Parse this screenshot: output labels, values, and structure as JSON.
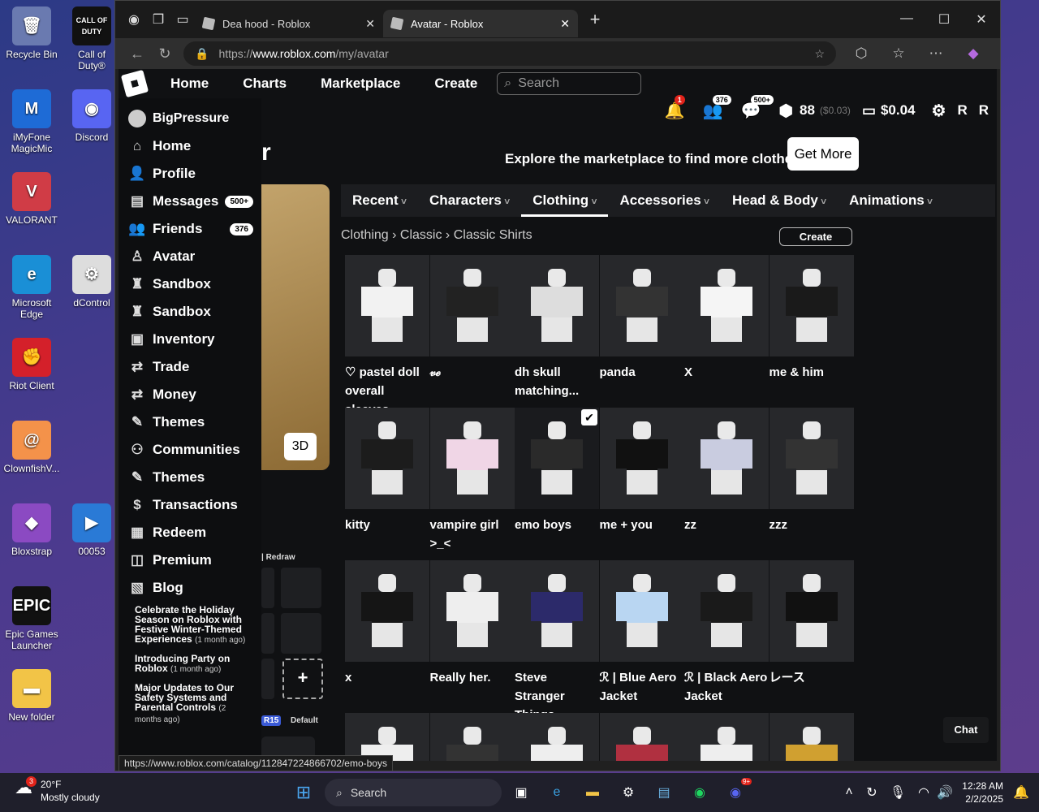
{
  "desktop": {
    "icons": [
      {
        "label": "Recycle Bin",
        "glyph": "🗑",
        "color": "#6a7ab0"
      },
      {
        "label": "Call of Duty®",
        "glyph": "CALL OF DUTY",
        "color": "#111"
      },
      {
        "label": "iMyFone MagicMic",
        "glyph": "M",
        "color": "#1e6bd6"
      },
      {
        "label": "Discord",
        "glyph": "◉",
        "color": "#5865f2"
      },
      {
        "label": "VALORANT",
        "glyph": "V",
        "color": "#d03c46"
      },
      {
        "label": "Microsoft Edge",
        "glyph": "e",
        "color": "#1a8fd6"
      },
      {
        "label": "dControl",
        "glyph": "⚙",
        "color": "#ddd"
      },
      {
        "label": "Riot Client",
        "glyph": "✊",
        "color": "#d4202a"
      },
      {
        "label": "ClownfishV...",
        "glyph": "@",
        "color": "#f4924a"
      },
      {
        "label": "Bloxstrap",
        "glyph": "◆",
        "color": "#8b4ac2"
      },
      {
        "label": "00053",
        "glyph": "▶",
        "color": "#2a7ad6"
      },
      {
        "label": "Epic Games Launcher",
        "glyph": "EPIC",
        "color": "#111"
      },
      {
        "label": "New folder",
        "glyph": "▬",
        "color": "#f2c447"
      }
    ]
  },
  "browser": {
    "tabs": [
      {
        "title": "Dea hood - Roblox",
        "active": false
      },
      {
        "title": "Avatar - Roblox",
        "active": true
      }
    ],
    "url_prefix": "https://",
    "url_host": "www.roblox.com",
    "url_path": "/my/avatar",
    "status_url": "https://www.roblox.com/catalog/112847224866702/emo-boys"
  },
  "topnav": {
    "links": [
      "Home",
      "Charts",
      "Marketplace",
      "Create"
    ],
    "search_placeholder": "Search"
  },
  "header": {
    "notif_count": "1",
    "friends_count": "376",
    "messages_count": "500+",
    "robux": "88",
    "robux_usd": "($0.03)",
    "cash": "$0.04"
  },
  "sidebar": {
    "username": "BigPressure",
    "items": [
      {
        "label": "Home",
        "icon": "⌂",
        "pill": ""
      },
      {
        "label": "Profile",
        "icon": "👤",
        "pill": ""
      },
      {
        "label": "Messages",
        "icon": "▤",
        "pill": "500+"
      },
      {
        "label": "Friends",
        "icon": "👥",
        "pill": "376"
      },
      {
        "label": "Avatar",
        "icon": "♙",
        "pill": ""
      },
      {
        "label": "Sandbox",
        "icon": "♜",
        "pill": ""
      },
      {
        "label": "Sandbox",
        "icon": "♜",
        "pill": ""
      },
      {
        "label": "Inventory",
        "icon": "▣",
        "pill": ""
      },
      {
        "label": "Trade",
        "icon": "⇄",
        "pill": ""
      },
      {
        "label": "Money",
        "icon": "⇄",
        "pill": ""
      },
      {
        "label": "Themes",
        "icon": "✎",
        "pill": ""
      },
      {
        "label": "Communities",
        "icon": "⚇",
        "pill": ""
      },
      {
        "label": "Themes",
        "icon": "✎",
        "pill": ""
      },
      {
        "label": "Transactions",
        "icon": "$",
        "pill": ""
      },
      {
        "label": "Redeem",
        "icon": "▦",
        "pill": ""
      },
      {
        "label": "Premium",
        "icon": "◫",
        "pill": ""
      },
      {
        "label": "Blog",
        "icon": "▧",
        "pill": ""
      }
    ],
    "blog_posts": [
      {
        "title": "Celebrate the Holiday Season on Roblox with Festive Winter-Themed Experiences",
        "age": "(1 month ago)"
      },
      {
        "title": "Introducing Party on Roblox",
        "age": "(1 month ago)"
      },
      {
        "title": "Major Updates to Our Safety Systems and Parental Controls",
        "age": "(2 months ago)"
      }
    ]
  },
  "main": {
    "title_fragment": "r",
    "promo_text": "Explore the marketplace to find more clothes!",
    "get_more_label": "Get More",
    "btn_3d": "3D",
    "redraw_fragment": "| Redraw",
    "r15_label": "R15",
    "default_label": "Default",
    "category_tabs": [
      {
        "label": "Recent",
        "active": false
      },
      {
        "label": "Characters",
        "active": false
      },
      {
        "label": "Clothing",
        "active": true
      },
      {
        "label": "Accessories",
        "active": false
      },
      {
        "label": "Head & Body",
        "active": false
      },
      {
        "label": "Animations",
        "active": false
      }
    ],
    "breadcrumb": [
      "Clothing",
      "Classic",
      "Classic Shirts"
    ],
    "create_label": "Create",
    "items": [
      {
        "name": "♡ pastel doll overall sleeves...",
        "shirt": "#f2f2f2",
        "selected": false
      },
      {
        "name": "𝓋ℯ",
        "shirt": "#222",
        "selected": false
      },
      {
        "name": "dh skull matching...",
        "shirt": "#ddd",
        "selected": false
      },
      {
        "name": "panda",
        "shirt": "#333",
        "selected": false
      },
      {
        "name": "X",
        "shirt": "#f5f5f5",
        "selected": false
      },
      {
        "name": "me & him",
        "shirt": "#1a1a1a",
        "selected": false
      },
      {
        "name": "kitty",
        "shirt": "#1c1c1c",
        "selected": false
      },
      {
        "name": "vampire girl >_<",
        "shirt": "#f0d6e6",
        "selected": false
      },
      {
        "name": "emo boys",
        "shirt": "#2a2a2a",
        "selected": true
      },
      {
        "name": "me + you",
        "shirt": "#111",
        "selected": false
      },
      {
        "name": "zz",
        "shirt": "#c9cce0",
        "selected": false
      },
      {
        "name": "zzz",
        "shirt": "#333",
        "selected": false
      },
      {
        "name": "x",
        "shirt": "#151515",
        "selected": false
      },
      {
        "name": "Really her.",
        "shirt": "#eee",
        "selected": false
      },
      {
        "name": "Steve Stranger Things Scoops...",
        "shirt": "#2c2a6a",
        "selected": false
      },
      {
        "name": "ℛ | Blue Aero Jacket",
        "shirt": "#b9d6f2",
        "selected": false
      },
      {
        "name": "ℛ | Black Aero Jacket",
        "shirt": "#1a1a1a",
        "selected": false
      },
      {
        "name": "レース",
        "shirt": "#111",
        "selected": false
      },
      {
        "name": "",
        "shirt": "#eee",
        "selected": false
      },
      {
        "name": "",
        "shirt": "#333",
        "selected": false
      },
      {
        "name": "",
        "shirt": "#eee",
        "selected": false
      },
      {
        "name": "",
        "shirt": "#b03040",
        "selected": false
      },
      {
        "name": "",
        "shirt": "#eee",
        "selected": false
      },
      {
        "name": "",
        "shirt": "#d0a030",
        "selected": false
      }
    ],
    "chat_label": "Chat"
  },
  "taskbar": {
    "weather_temp": "20°F",
    "weather_desc": "Mostly cloudy",
    "weather_badge": "3",
    "search_placeholder": "Search",
    "time": "12:28 AM",
    "date": "2/2/2025",
    "discord_badge": "9+"
  }
}
